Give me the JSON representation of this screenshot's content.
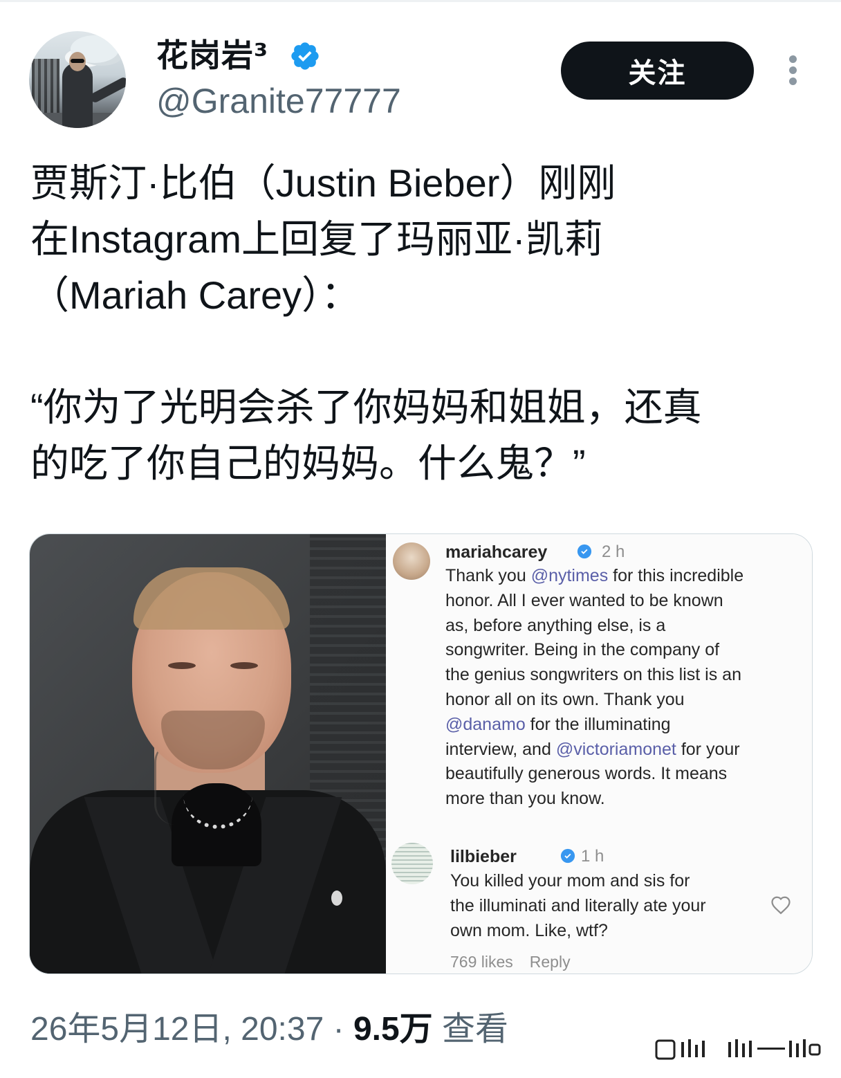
{
  "author": {
    "display_name": "花岗岩³",
    "handle": "@Granite77777",
    "verified": true
  },
  "follow_button": {
    "label": "关注"
  },
  "tweet": {
    "lines": [
      "贾斯汀·比伯（Justin Bieber）刚刚",
      "在Instagram上回复了玛丽亚·凯莉",
      "（Mariah Carey）：",
      "",
      "“你为了光明会杀了你妈妈和姐姐，还真",
      "的吃了你自己的妈妈。什么鬼？”"
    ]
  },
  "media": {
    "comments": [
      {
        "user": "mariahcarey",
        "time": "2 h",
        "verified": true,
        "lines": [
          [
            "Thank you ",
            "@nytimes",
            " for this incredible"
          ],
          [
            "honor. All I ever wanted to be known"
          ],
          [
            "as, before anything else, is a"
          ],
          [
            "songwriter. Being in the company of"
          ],
          [
            "the genius songwriters on this list is an"
          ],
          [
            "honor all on its own. Thank you"
          ],
          [
            "",
            "@danamo",
            " for the illuminating"
          ],
          [
            "interview, and ",
            "@victoriamonet",
            " for your"
          ],
          [
            "beautifully generous words. It means"
          ],
          [
            "more than you know."
          ]
        ]
      },
      {
        "user": "lilbieber",
        "time": "1 h",
        "verified": true,
        "lines": [
          [
            "You killed your mom and sis for"
          ],
          [
            "the illuminati and literally ate your"
          ],
          [
            "own mom. Like, wtf?"
          ]
        ],
        "likes": "769 likes",
        "reply_label": "Reply"
      }
    ]
  },
  "footer": {
    "timestamp": "26年5月12日, 20:37",
    "separator": "·",
    "views_count": "9.5万",
    "views_label": "查看"
  },
  "colors": {
    "verified_blue": "#1d9bf0",
    "button_bg": "#0f1419",
    "secondary_text": "#536471",
    "mention": "#5a5fa8"
  }
}
